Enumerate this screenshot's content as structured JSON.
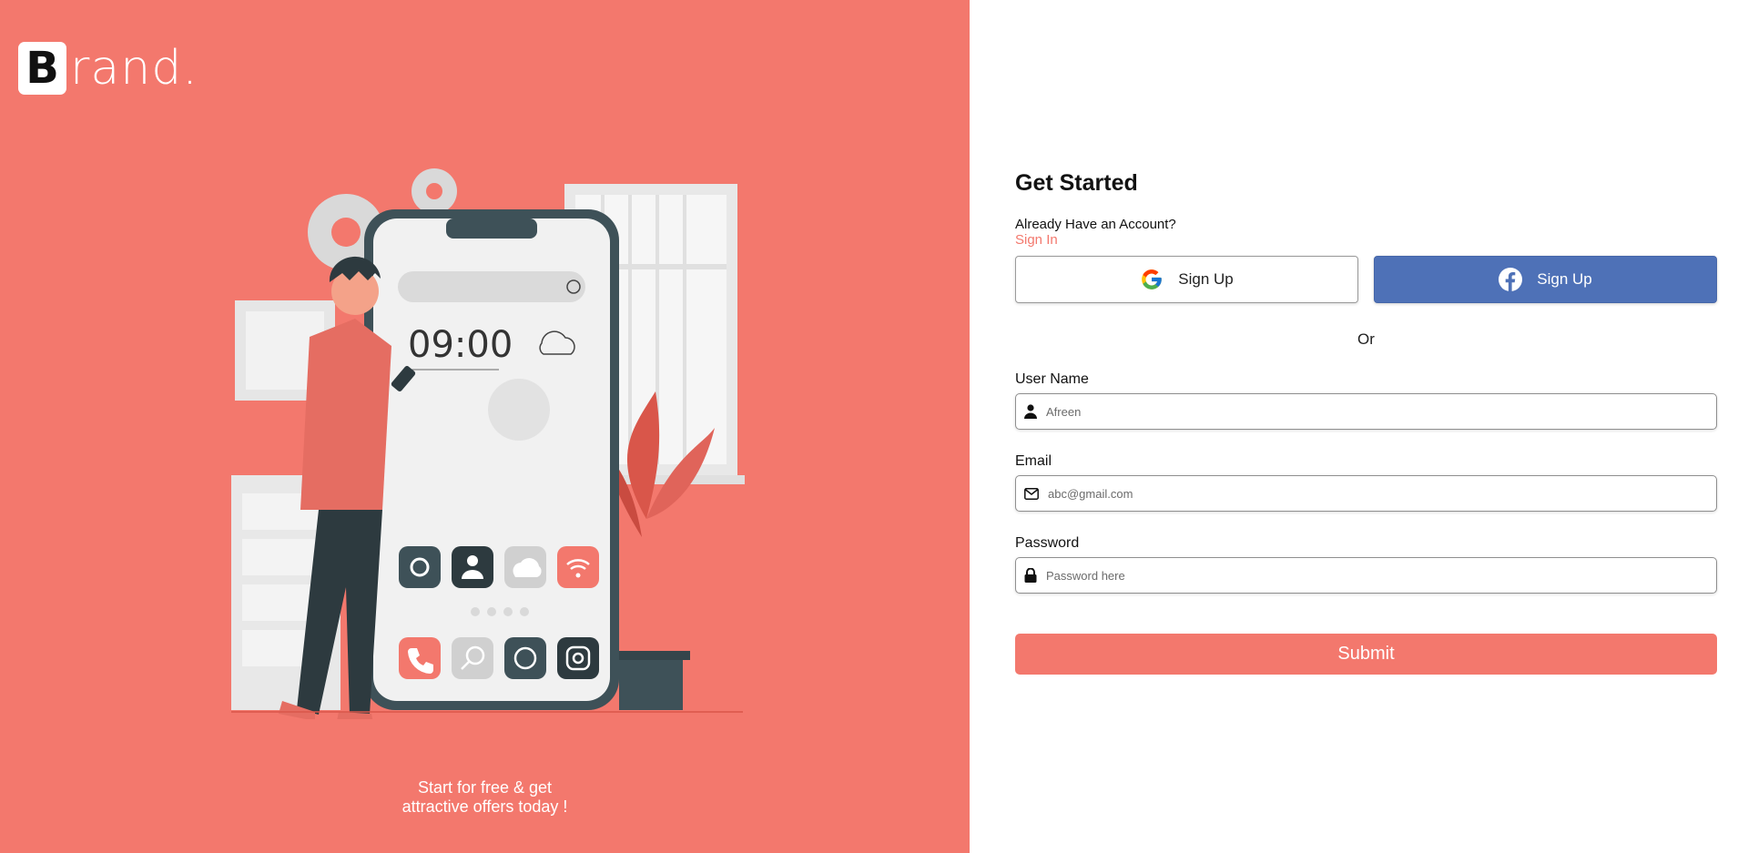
{
  "brand": {
    "letter": "B",
    "rest": "rand."
  },
  "illustration": {
    "clock_time": "09:00"
  },
  "tagline": {
    "line1": "Start for free & get",
    "line2": "attractive offers today !"
  },
  "form": {
    "title": "Get Started",
    "have_account": "Already Have an Account?",
    "sign_in": "Sign In",
    "google_label": "Sign Up",
    "facebook_label": "Sign Up",
    "or": "Or",
    "username": {
      "label": "User Name",
      "placeholder": "Afreen"
    },
    "email": {
      "label": "Email",
      "placeholder": "abc@gmail.com"
    },
    "password": {
      "label": "Password",
      "placeholder": "Password here"
    },
    "submit": "Submit"
  },
  "colors": {
    "accent": "#F3786D",
    "facebook": "#4E71B7",
    "dark": "#2D3A3F"
  },
  "icons": [
    "google-icon",
    "facebook-icon",
    "user-icon",
    "mail-icon",
    "lock-icon"
  ]
}
